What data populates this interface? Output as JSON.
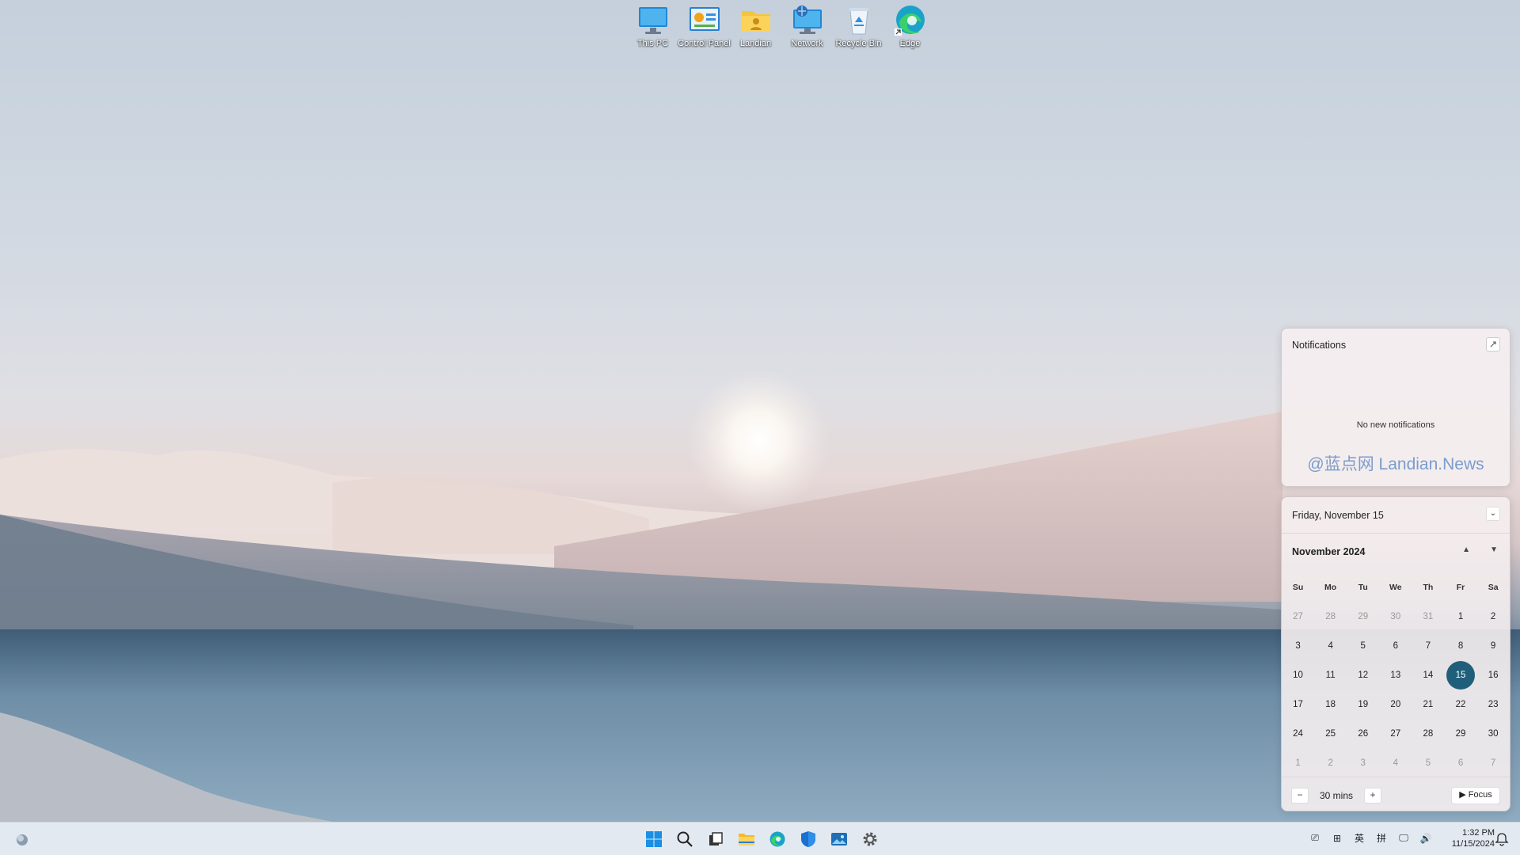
{
  "desktop": {
    "icons": [
      {
        "label": "This PC",
        "icon": "monitor-icon"
      },
      {
        "label": "Control Panel",
        "icon": "control-panel-icon"
      },
      {
        "label": "Landian",
        "icon": "user-folder-icon"
      },
      {
        "label": "Network",
        "icon": "network-icon"
      },
      {
        "label": "Recycle Bin",
        "icon": "recycle-bin-icon"
      },
      {
        "label": "Edge",
        "icon": "edge-icon"
      }
    ]
  },
  "notifications": {
    "title": "Notifications",
    "empty_text": "No new notifications",
    "watermark": "@蓝点网 Landian.News"
  },
  "calendar": {
    "date_header": "Friday, November 15",
    "month_label": "November 2024",
    "weekdays": [
      "Su",
      "Mo",
      "Tu",
      "We",
      "Th",
      "Fr",
      "Sa"
    ],
    "days": [
      {
        "d": "27",
        "other": true
      },
      {
        "d": "28",
        "other": true
      },
      {
        "d": "29",
        "other": true
      },
      {
        "d": "30",
        "other": true
      },
      {
        "d": "31",
        "other": true
      },
      {
        "d": "1"
      },
      {
        "d": "2"
      },
      {
        "d": "3"
      },
      {
        "d": "4"
      },
      {
        "d": "5"
      },
      {
        "d": "6"
      },
      {
        "d": "7"
      },
      {
        "d": "8"
      },
      {
        "d": "9"
      },
      {
        "d": "10"
      },
      {
        "d": "11"
      },
      {
        "d": "12"
      },
      {
        "d": "13"
      },
      {
        "d": "14"
      },
      {
        "d": "15",
        "today": true
      },
      {
        "d": "16"
      },
      {
        "d": "17"
      },
      {
        "d": "18"
      },
      {
        "d": "19"
      },
      {
        "d": "20"
      },
      {
        "d": "21"
      },
      {
        "d": "22"
      },
      {
        "d": "23"
      },
      {
        "d": "24"
      },
      {
        "d": "25"
      },
      {
        "d": "26"
      },
      {
        "d": "27"
      },
      {
        "d": "28"
      },
      {
        "d": "29"
      },
      {
        "d": "30"
      },
      {
        "d": "1",
        "other": true
      },
      {
        "d": "2",
        "other": true
      },
      {
        "d": "3",
        "other": true
      },
      {
        "d": "4",
        "other": true
      },
      {
        "d": "5",
        "other": true
      },
      {
        "d": "6",
        "other": true
      },
      {
        "d": "7",
        "other": true
      }
    ],
    "focus": {
      "minus": "−",
      "duration": "30 mins",
      "plus": "+",
      "button": "▶ Focus"
    }
  },
  "taskbar": {
    "tray": [
      "⎚",
      "⊞",
      "英",
      "拼",
      "🖵",
      "🔊"
    ],
    "clock_time": "1:32 PM",
    "clock_date": "11/15/2024",
    "accent": "#1f5f7a"
  }
}
